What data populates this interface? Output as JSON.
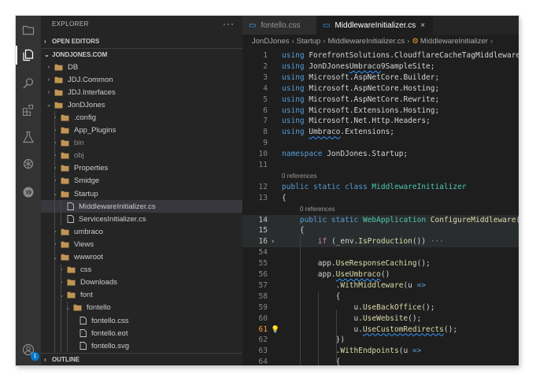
{
  "explorer": {
    "title": "EXPLORER",
    "more": "···",
    "open_editors": "OPEN EDITORS",
    "workspace": "JONDJONES.COM",
    "outline": "OUTLINE",
    "tree": [
      {
        "label": "DB",
        "indent": 0,
        "type": "folder-closed"
      },
      {
        "label": "JDJ.Common",
        "indent": 0,
        "type": "folder-closed"
      },
      {
        "label": "JDJ.Interfaces",
        "indent": 0,
        "type": "folder-closed"
      },
      {
        "label": "JonDJones",
        "indent": 0,
        "type": "folder-open"
      },
      {
        "label": ".config",
        "indent": 1,
        "type": "folder-closed"
      },
      {
        "label": "App_Plugins",
        "indent": 1,
        "type": "folder-closed"
      },
      {
        "label": "bin",
        "indent": 1,
        "type": "folder-closed",
        "dim": true
      },
      {
        "label": "obj",
        "indent": 1,
        "type": "folder-closed",
        "dim": true
      },
      {
        "label": "Properties",
        "indent": 1,
        "type": "folder-closed"
      },
      {
        "label": "Smidge",
        "indent": 1,
        "type": "folder-closed"
      },
      {
        "label": "Startup",
        "indent": 1,
        "type": "folder-open"
      },
      {
        "label": "MiddlewareInitializer.cs",
        "indent": 2,
        "type": "file",
        "selected": true
      },
      {
        "label": "ServicesInitializer.cs",
        "indent": 2,
        "type": "file"
      },
      {
        "label": "umbraco",
        "indent": 1,
        "type": "folder-closed"
      },
      {
        "label": "Views",
        "indent": 1,
        "type": "folder-closed"
      },
      {
        "label": "wwwroot",
        "indent": 1,
        "type": "folder-open"
      },
      {
        "label": "css",
        "indent": 2,
        "type": "folder-closed"
      },
      {
        "label": "Downloads",
        "indent": 2,
        "type": "folder-closed"
      },
      {
        "label": "font",
        "indent": 2,
        "type": "folder-open"
      },
      {
        "label": "fontello",
        "indent": 3,
        "type": "folder-open"
      },
      {
        "label": "fontello.css",
        "indent": 4,
        "type": "file"
      },
      {
        "label": "fontello.eot",
        "indent": 4,
        "type": "file"
      },
      {
        "label": "fontello.svg",
        "indent": 4,
        "type": "file"
      }
    ]
  },
  "tabs": [
    {
      "label": "fontello.css",
      "active": false
    },
    {
      "label": "MiddlewareInitializer.cs",
      "active": true,
      "close": "×"
    }
  ],
  "breadcrumb": [
    "JonDJones",
    "Startup",
    "MiddlewareInitializer.cs",
    "MiddlewareInitializer"
  ],
  "activity": {
    "items": [
      "files-icon",
      "explorer-icon",
      "search-icon",
      "extensions-icon",
      "testing-icon",
      "openai-icon",
      "remote-icon"
    ],
    "account_badge": "1"
  },
  "code": [
    {
      "n": "1",
      "t": [
        [
          "kw",
          "using"
        ],
        [
          "ns",
          " ForefrontSolutions.CloudflareCacheTagMiddleware"
        ]
      ]
    },
    {
      "n": "2",
      "t": [
        [
          "kw",
          "using"
        ],
        [
          "ns",
          " JonDJones"
        ],
        [
          "sq",
          "Umbraco"
        ],
        [
          "ns",
          "9SampleSite;"
        ]
      ]
    },
    {
      "n": "3",
      "t": [
        [
          "kw",
          "using"
        ],
        [
          "ns",
          " Microsoft.AspNetCore.Builder;"
        ]
      ]
    },
    {
      "n": "4",
      "t": [
        [
          "kw",
          "using"
        ],
        [
          "ns",
          " Microsoft.AspNetCore.Hosting;"
        ]
      ]
    },
    {
      "n": "5",
      "t": [
        [
          "kw",
          "using"
        ],
        [
          "ns",
          " Microsoft.AspNetCore.Rewrite;"
        ]
      ]
    },
    {
      "n": "6",
      "t": [
        [
          "kw",
          "using"
        ],
        [
          "ns",
          " Microsoft.Extensions.Hosting;"
        ]
      ]
    },
    {
      "n": "7",
      "t": [
        [
          "kw",
          "using"
        ],
        [
          "ns",
          " Microsoft.Net.Http.Headers;"
        ]
      ]
    },
    {
      "n": "8",
      "t": [
        [
          "kw",
          "using"
        ],
        [
          "ns",
          " "
        ],
        [
          "sq",
          "Umbraco"
        ],
        [
          "ns",
          ".Extensions;"
        ]
      ]
    },
    {
      "n": "9",
      "t": []
    },
    {
      "n": "10",
      "t": [
        [
          "kw",
          "namespace"
        ],
        [
          "ns",
          " JonDJones.Startup;"
        ]
      ]
    },
    {
      "n": "11",
      "t": []
    },
    {
      "lens": "0 references"
    },
    {
      "n": "12",
      "t": [
        [
          "kw",
          "public static class"
        ],
        [
          "ns",
          " "
        ],
        [
          "ty",
          "MiddlewareInitializer"
        ]
      ]
    },
    {
      "n": "13",
      "t": [
        [
          "ns",
          "{"
        ]
      ]
    },
    {
      "lens": "0 references",
      "indent": 1
    },
    {
      "n": "14",
      "t": [
        [
          "ns",
          "    "
        ],
        [
          "kw",
          "public static"
        ],
        [
          "ns",
          " "
        ],
        [
          "ty",
          "WebApplication"
        ],
        [
          "ns",
          " "
        ],
        [
          "fn",
          "ConfigureMiddleware"
        ],
        [
          "ns",
          "("
        ],
        [
          "kw",
          "t"
        ]
      ],
      "hl": true
    },
    {
      "n": "15",
      "t": [
        [
          "ns",
          "    {"
        ]
      ],
      "hl": true
    },
    {
      "n": "16",
      "t": [
        [
          "ns",
          "        "
        ],
        [
          "ctl",
          "if"
        ],
        [
          "ns",
          " (_env."
        ],
        [
          "fn",
          "IsProduction"
        ],
        [
          "ns",
          "())"
        ],
        [
          "ell",
          " ···"
        ]
      ],
      "fold": true,
      "hl": true
    },
    {
      "n": "54",
      "t": []
    },
    {
      "n": "55",
      "t": [
        [
          "ns",
          "        app."
        ],
        [
          "fn",
          "UseResponseCaching"
        ],
        [
          "ns",
          "();"
        ]
      ]
    },
    {
      "n": "56",
      "t": [
        [
          "ns",
          "        app."
        ],
        [
          "sqfn",
          "UseUmbraco"
        ],
        [
          "ns",
          "()"
        ]
      ]
    },
    {
      "n": "57",
      "t": [
        [
          "ns",
          "            ."
        ],
        [
          "fn",
          "WithMiddleware"
        ],
        [
          "ns",
          "(u "
        ],
        [
          "kw",
          "=>"
        ]
      ]
    },
    {
      "n": "58",
      "t": [
        [
          "ns",
          "            {"
        ]
      ]
    },
    {
      "n": "59",
      "t": [
        [
          "ns",
          "                u."
        ],
        [
          "fn",
          "UseBackOffice"
        ],
        [
          "ns",
          "();"
        ]
      ]
    },
    {
      "n": "60",
      "t": [
        [
          "ns",
          "                u."
        ],
        [
          "fn",
          "UseWebsite"
        ],
        [
          "ns",
          "();"
        ]
      ]
    },
    {
      "n": "61",
      "t": [
        [
          "ns",
          "                u."
        ],
        [
          "sqfn",
          "UseCustomRedirects"
        ],
        [
          "ns",
          "();"
        ]
      ],
      "warn": true
    },
    {
      "n": "62",
      "t": [
        [
          "ns",
          "            })"
        ]
      ]
    },
    {
      "n": "63",
      "t": [
        [
          "ns",
          "            ."
        ],
        [
          "fn",
          "WithEndpoints"
        ],
        [
          "ns",
          "(u "
        ],
        [
          "kw",
          "=>"
        ]
      ]
    },
    {
      "n": "64",
      "t": [
        [
          "ns",
          "            {"
        ]
      ]
    }
  ]
}
